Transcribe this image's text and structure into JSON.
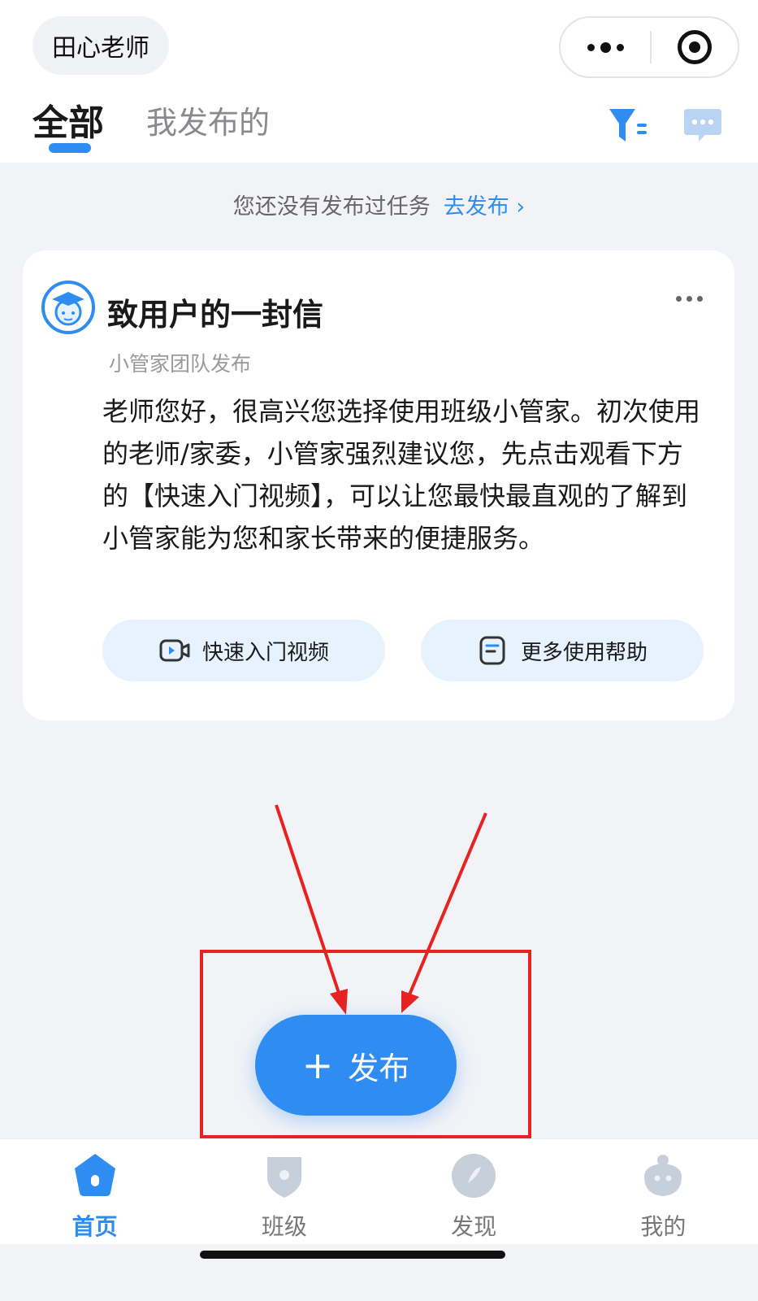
{
  "header": {
    "user_name": "田心老师"
  },
  "tabs": {
    "all": "全部",
    "mine": "我发布的"
  },
  "notice": {
    "text": "您还没有发布过任务",
    "link": "去发布 ›"
  },
  "card": {
    "title": "致用户的一封信",
    "subtitle": "小管家团队发布",
    "body": "老师您好，很高兴您选择使用班级小管家。初次使用的老师/家委，小管家强烈建议您，先点击观看下方的【快速入门视频】，可以让您最快最直观的了解到小管家能为您和家长带来的便捷服务。",
    "button_video": "快速入门视频",
    "button_help": "更多使用帮助"
  },
  "publish": {
    "plus": "+",
    "label": "发布"
  },
  "tabbar": {
    "items": [
      {
        "label": "首页",
        "icon": "home-icon",
        "active": true
      },
      {
        "label": "班级",
        "icon": "class-badge-icon",
        "active": false
      },
      {
        "label": "发现",
        "icon": "discover-icon",
        "active": false
      },
      {
        "label": "我的",
        "icon": "profile-icon",
        "active": false
      }
    ]
  },
  "colors": {
    "accent": "#2f8cf0",
    "annotation_red": "#e62222",
    "background": "#f2f3f7"
  }
}
